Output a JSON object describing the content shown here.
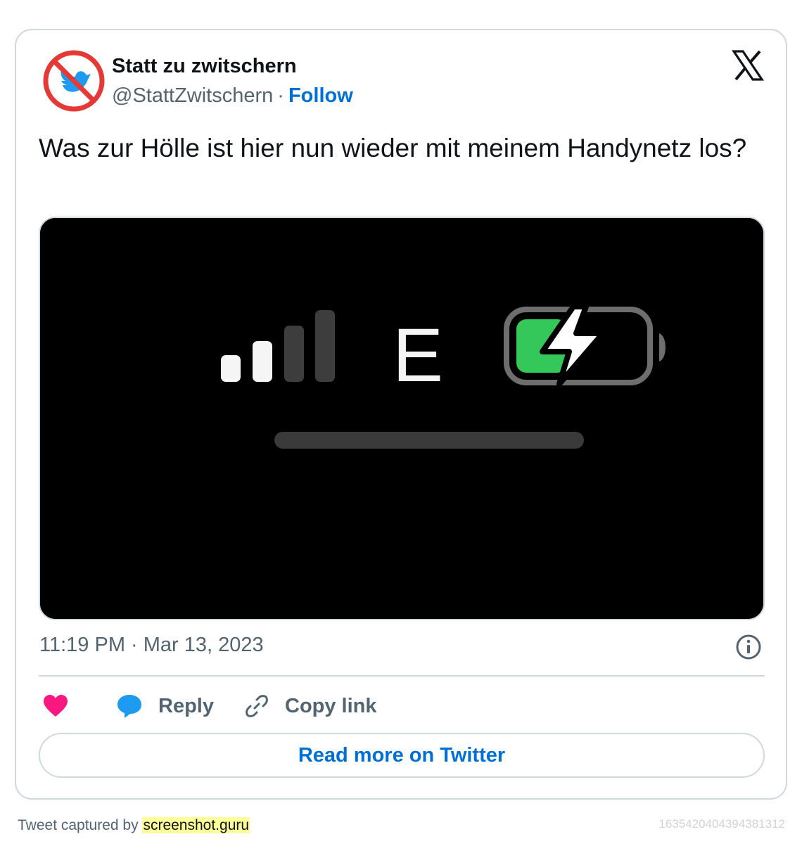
{
  "author": {
    "name": "Statt zu zwitschern",
    "handle": "@StattZwitschern",
    "separator": "·",
    "follow_label": "Follow"
  },
  "tweet": {
    "text": "Was zur Hölle ist hier nun wieder mit meinem Handynetz los?",
    "timestamp": "11:19 PM · Mar 13, 2023"
  },
  "media": {
    "network_type": "E",
    "signal_bars_filled": 2,
    "signal_bars_total": 4,
    "battery_level": 0.35,
    "battery_charging": true,
    "colors": {
      "battery_fill": "#34c759",
      "background": "#000000"
    }
  },
  "actions": {
    "reply_label": "Reply",
    "copy_label": "Copy link"
  },
  "read_more_label": "Read more on Twitter",
  "footer": {
    "captured_by": "Tweet captured by",
    "brand": "screenshot.guru",
    "tweet_id": "1635420404394381312"
  },
  "icons": [
    "no-bird-avatar",
    "x-logo-icon",
    "info-icon",
    "heart-icon",
    "reply-bubble-icon",
    "link-icon"
  ],
  "colors": {
    "accent": "#006fd6",
    "like": "#f91880",
    "reply": "#1d9bf0",
    "border": "#cfd9de",
    "muted": "#536471"
  }
}
